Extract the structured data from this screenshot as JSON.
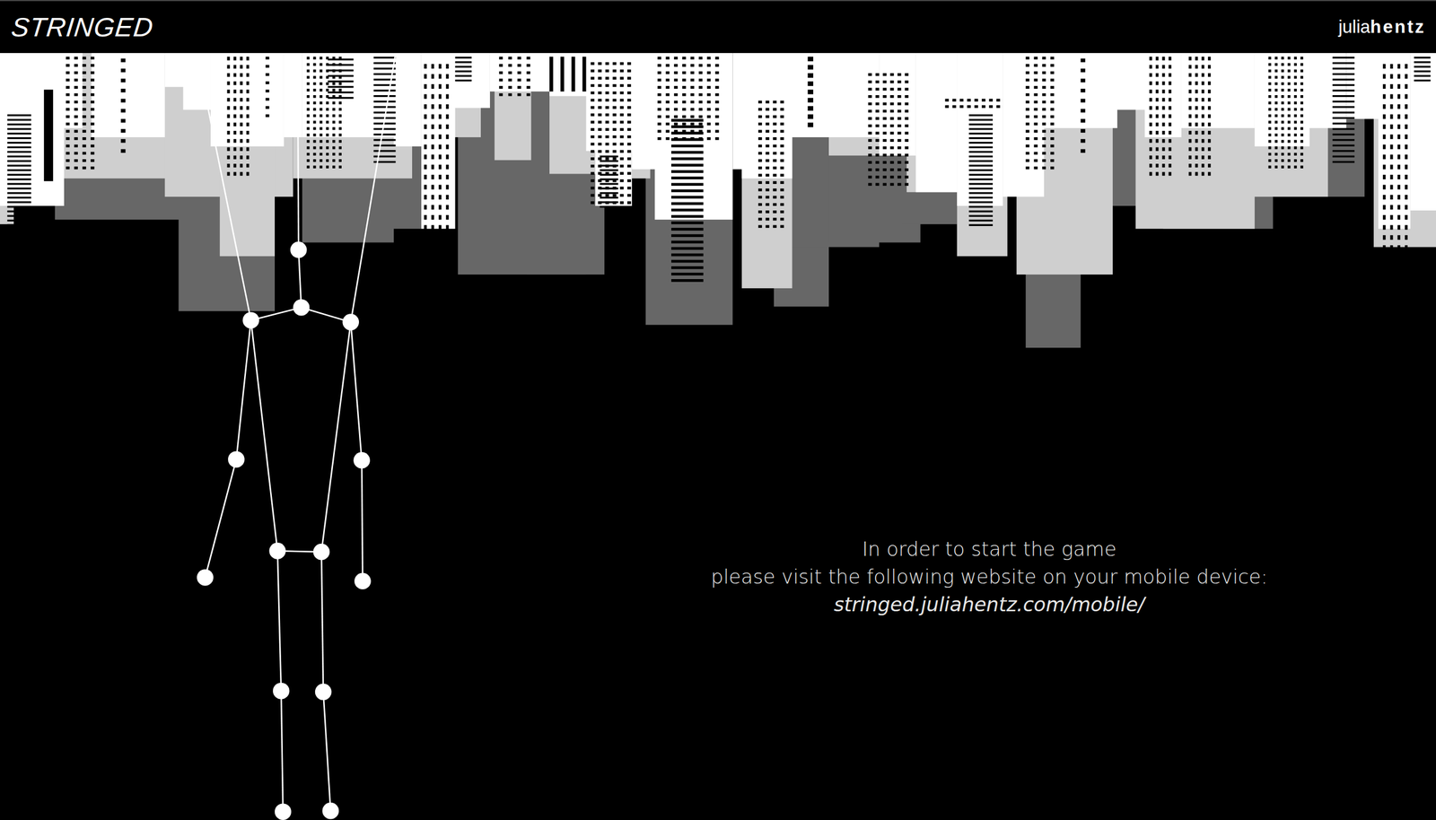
{
  "header": {
    "logo": "STRINGED",
    "brand": {
      "light": "julia",
      "bold": "hentz"
    }
  },
  "message": {
    "lines": [
      "In order to start the game",
      "please visit the following website on your mobile device:"
    ],
    "link": "stringed.juliahentz.com/mobile/"
  }
}
